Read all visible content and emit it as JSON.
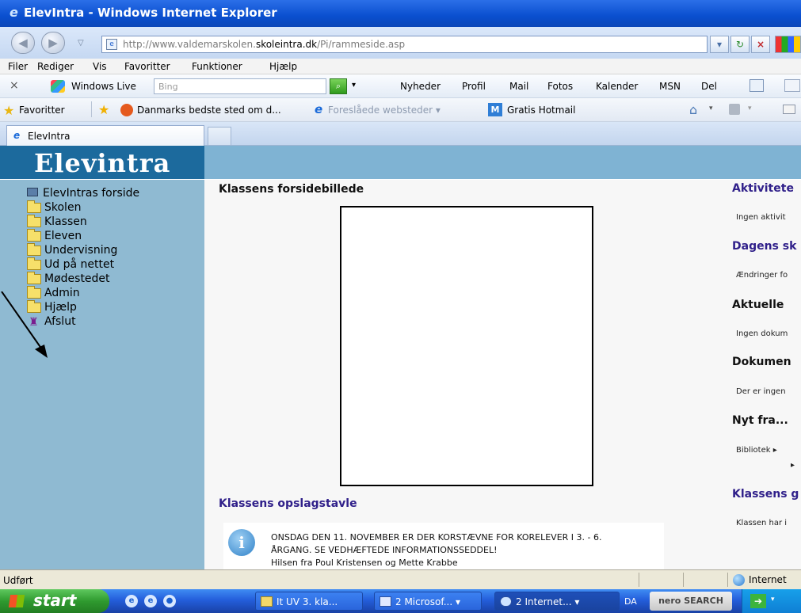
{
  "window": {
    "title": "ElevIntra - Windows Internet Explorer"
  },
  "address": {
    "url_prefix": "http://www.valdemarskolen.",
    "url_domain": "skoleintra.dk",
    "url_path": "/Pi/rammeside.asp"
  },
  "menu": [
    "Filer",
    "Rediger",
    "Vis",
    "Favoritter",
    "Funktioner",
    "Hjælp"
  ],
  "livebar": {
    "close": "×",
    "windows_live": "Windows Live",
    "search_placeholder": "Bing",
    "links": [
      "Nyheder",
      "Profil",
      "Mail",
      "Fotos",
      "Kalender",
      "MSN",
      "Del"
    ]
  },
  "favbar": {
    "favorites": "Favoritter",
    "items": [
      "Danmarks bedste sted om d...",
      "Foreslåede websteder ▾",
      "Gratis Hotmail"
    ]
  },
  "tab": {
    "title": "ElevIntra"
  },
  "site": {
    "logo": "Elevintra",
    "tree_root": "ElevIntras forside",
    "tree_items": [
      "Skolen",
      "Klassen",
      "Eleven",
      "Undervisning",
      "Ud på nettet",
      "Mødestedet",
      "Admin",
      "Hjælp"
    ],
    "tree_exit": "Afslut"
  },
  "main": {
    "picture_heading": "Klassens forsidebillede",
    "board_heading": "Klassens opslagstavle",
    "notice_lines": [
      "ONSDAG DEN 11. NOVEMBER ER DER KORSTÆVNE FOR KORELEVER I 3. - 6.",
      "ÅRGANG. SE VEDHÆFTEDE INFORMATIONSSEDDEL!",
      "Hilsen fra Poul Kristensen og Mette Krabbe"
    ]
  },
  "right_column": {
    "h1": "Aktivitete",
    "s1": "Ingen aktivit",
    "h2": "Dagens sk",
    "s2": "Ændringer fo",
    "h3": "Aktuelle",
    "s3": "Ingen dokum",
    "h4": "Dokumen",
    "s4": "Der er ingen",
    "h5": "Nyt fra...",
    "s5": "Bibliotek ▸",
    "h6": "Klassens g",
    "s6": "Klassen har i"
  },
  "status": {
    "text": "Udført",
    "zone": "Internet"
  },
  "taskbar": {
    "start": "start",
    "tasks": [
      "It UV 3. kla...",
      "2 Microsof...  ▾",
      "2 Internet...  ▾"
    ],
    "lang": "DA",
    "nero": "nero SEARCH"
  },
  "colors": {
    "sidebar": "#8fbad2",
    "logo_bg": "#1c6a9d",
    "heading_purple": "#30208a"
  }
}
